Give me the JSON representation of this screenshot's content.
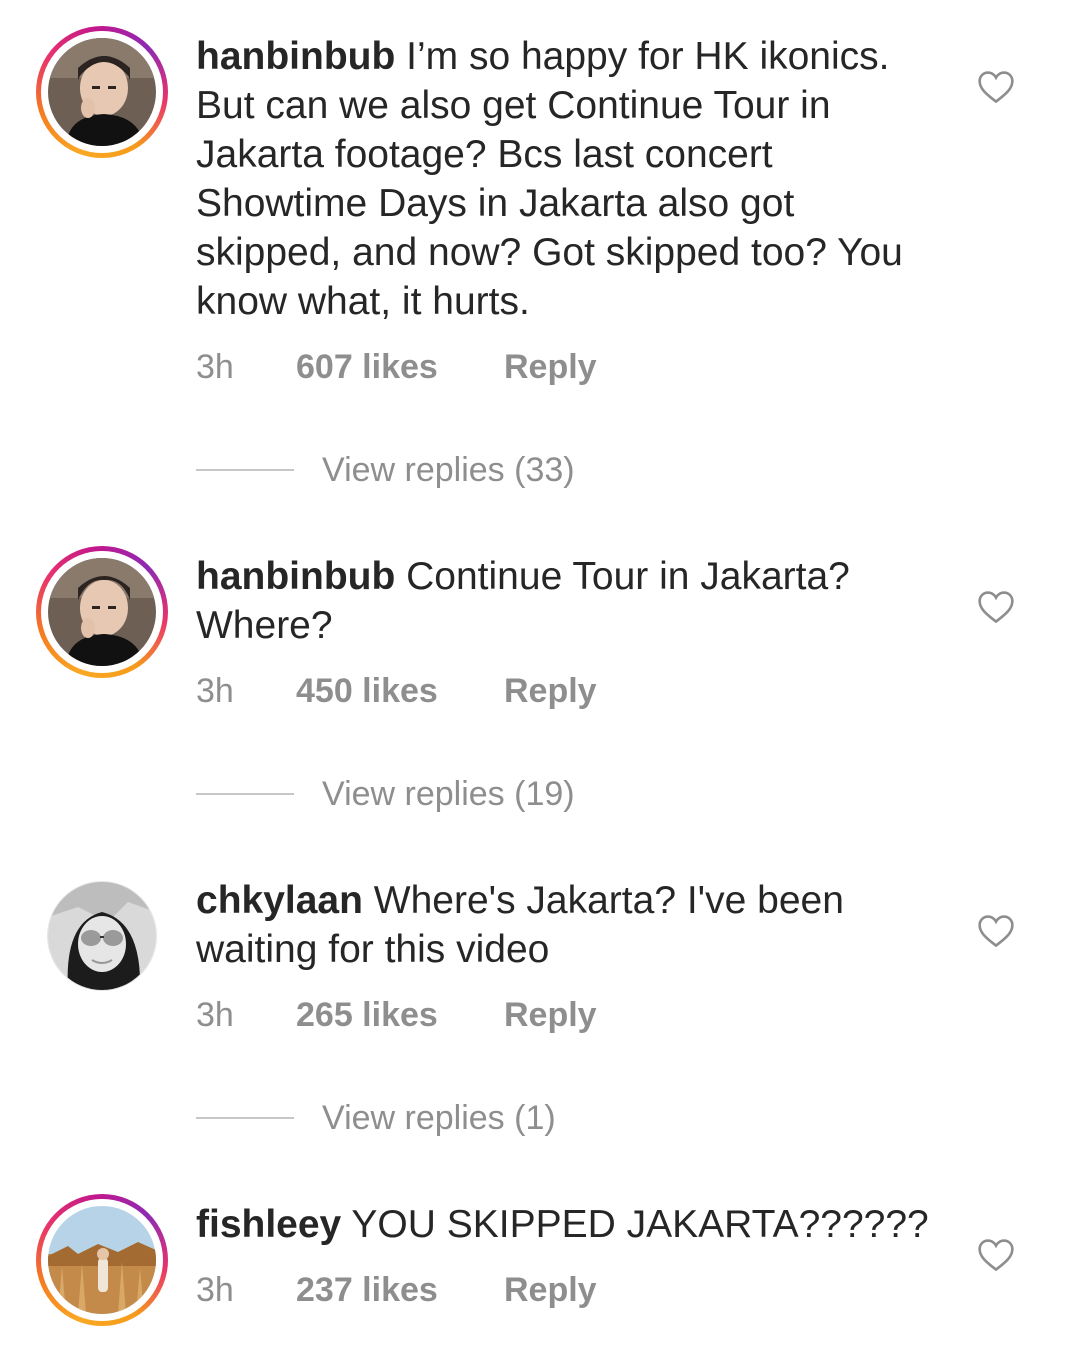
{
  "comments": [
    {
      "username": "hanbinbub",
      "text": "I’m so happy for HK ikonics. But can we also get Continue Tour in Jakarta footage? Bcs last concert Showtime Days in Jakarta also got skipped, and now? Got skipped too? You know what, it hurts.",
      "time": "3h",
      "likes": "607 likes",
      "reply": "Reply",
      "view_replies": "View replies (33)",
      "has_story_ring": true,
      "avatar_icon": "avatar-person-dark"
    },
    {
      "username": "hanbinbub",
      "text": "Continue Tour in Jakarta? Where?",
      "time": "3h",
      "likes": "450 likes",
      "reply": "Reply",
      "view_replies": "View replies (19)",
      "has_story_ring": true,
      "avatar_icon": "avatar-person-dark"
    },
    {
      "username": "chkylaan",
      "text": "Where's Jakarta?  I've been waiting for this video",
      "time": "3h",
      "likes": "265 likes",
      "reply": "Reply",
      "view_replies": "View replies (1)",
      "has_story_ring": false,
      "avatar_icon": "avatar-person-sunglasses"
    },
    {
      "username": "fishleey",
      "text": "YOU SKIPPED JAKARTA??????",
      "time": "3h",
      "likes": "237 likes",
      "reply": "Reply",
      "view_replies": "",
      "has_story_ring": true,
      "avatar_icon": "avatar-field-landscape"
    }
  ],
  "colors": {
    "text": "#262626",
    "meta": "#8e8e8e",
    "divider": "#c7c7c7",
    "ring_gradient": [
      "#f9a825",
      "#e8336d",
      "#8e2ab4"
    ]
  }
}
